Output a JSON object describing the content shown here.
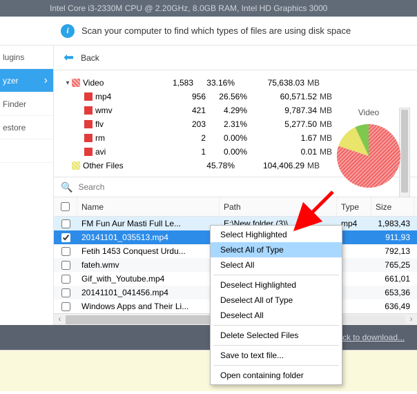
{
  "titlebar": "Intel Core i3-2330M CPU @ 2.20GHz, 8.0GB RAM, Intel HD Graphics 3000",
  "info_text": "Scan your computer to find which types of files are using disk space",
  "back_label": "Back",
  "sidebar": {
    "items": [
      {
        "label": "lugins"
      },
      {
        "label": "yzer"
      },
      {
        "label": "Finder"
      },
      {
        "label": "estore"
      },
      {
        "label": ""
      }
    ],
    "active_index": 1
  },
  "tree": {
    "rows": [
      {
        "indent": 0,
        "caret": "▾",
        "color": "#f26a6a",
        "hatch": true,
        "name": "Video",
        "count": "1,583",
        "pct": "33.16%",
        "size": "75,638.03",
        "unit": "MB"
      },
      {
        "indent": 1,
        "caret": "",
        "color": "#e23b3b",
        "hatch": false,
        "name": "mp4",
        "count": "956",
        "pct": "26.56%",
        "size": "60,571.52",
        "unit": "MB"
      },
      {
        "indent": 1,
        "caret": "",
        "color": "#e23b3b",
        "hatch": false,
        "name": "wmv",
        "count": "421",
        "pct": "4.29%",
        "size": "9,787.34",
        "unit": "MB"
      },
      {
        "indent": 1,
        "caret": "",
        "color": "#e23b3b",
        "hatch": false,
        "name": "flv",
        "count": "203",
        "pct": "2.31%",
        "size": "5,277.50",
        "unit": "MB"
      },
      {
        "indent": 1,
        "caret": "",
        "color": "#e23b3b",
        "hatch": false,
        "name": "rm",
        "count": "2",
        "pct": "0.00%",
        "size": "1.67",
        "unit": "MB"
      },
      {
        "indent": 1,
        "caret": "",
        "color": "#e23b3b",
        "hatch": false,
        "name": "avi",
        "count": "1",
        "pct": "0.00%",
        "size": "0.01",
        "unit": "MB"
      },
      {
        "indent": 0,
        "caret": "",
        "color": "#e9e46a",
        "hatch": true,
        "name": "Other Files",
        "count": "",
        "pct": "45.78%",
        "size": "104,406.29",
        "unit": "MB"
      }
    ]
  },
  "pie_label": "Video",
  "chart_data": {
    "type": "pie",
    "title": "Video",
    "series": [
      {
        "name": "mp4",
        "value": 26.56,
        "color": "#f26a6a"
      },
      {
        "name": "wmv",
        "value": 4.29,
        "color": "#e9e46a"
      },
      {
        "name": "flv",
        "value": 2.31,
        "color": "#7ec850"
      },
      {
        "name": "rm",
        "value": 0.0,
        "color": "#f6a23c"
      },
      {
        "name": "avi",
        "value": 0.0,
        "color": "#4aa3e0"
      }
    ]
  },
  "search": {
    "placeholder": "Search"
  },
  "table": {
    "headers": {
      "name": "Name",
      "path": "Path",
      "type": "Type",
      "size": "Size"
    },
    "rows": [
      {
        "checked": false,
        "name": "FM Fun Aur Masti    Full Le...",
        "path": "E:\\New folder (3)\\",
        "type": "mp4",
        "size": "1,983,43"
      },
      {
        "checked": true,
        "name": "20141101_035513.mp4",
        "path": "",
        "type": "",
        "size": "911,93"
      },
      {
        "checked": false,
        "name": "Fetih 1453 Conquest Urdu...",
        "path": "",
        "type": "",
        "size": "792,13"
      },
      {
        "checked": false,
        "name": "fateh.wmv",
        "path": "",
        "type": "",
        "size": "765,25"
      },
      {
        "checked": false,
        "name": "Gif_with_Youtube.mp4",
        "path": "",
        "type": "",
        "size": "661,01"
      },
      {
        "checked": false,
        "name": "20141101_041456.mp4",
        "path": "",
        "type": "",
        "size": "653,36"
      },
      {
        "checked": false,
        "name": "Windows Apps and Their Li...",
        "path": "",
        "type": "",
        "size": "636,49"
      }
    ],
    "selected_index": 1,
    "hover_index": 0
  },
  "context_menu": {
    "groups": [
      [
        "Select Highlighted",
        "Select All of Type",
        "Select All"
      ],
      [
        "Deselect Highlighted",
        "Deselect All of Type",
        "Deselect All"
      ],
      [
        "Delete Selected Files"
      ],
      [
        "Save to text file..."
      ],
      [
        "Open containing folder"
      ]
    ],
    "highlighted": "Select All of Type"
  },
  "footer_link": "ick to download..."
}
